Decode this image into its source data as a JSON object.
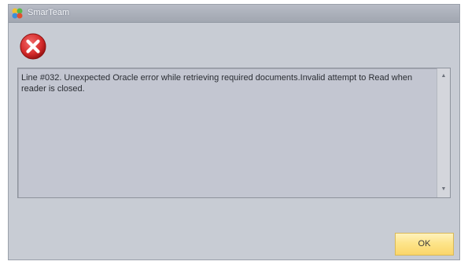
{
  "window": {
    "title": "SmarTeam",
    "app_icon": "smarteam-app-icon"
  },
  "dialog": {
    "icon": "error-icon",
    "message": "Line #032. Unexpected Oracle error while retrieving required documents.Invalid attempt to Read when reader is closed.",
    "ok_label": "OK"
  },
  "colors": {
    "dialog_background": "#c8ccd4",
    "error_red": "#d42a2a",
    "ok_button": "#fde48a"
  }
}
